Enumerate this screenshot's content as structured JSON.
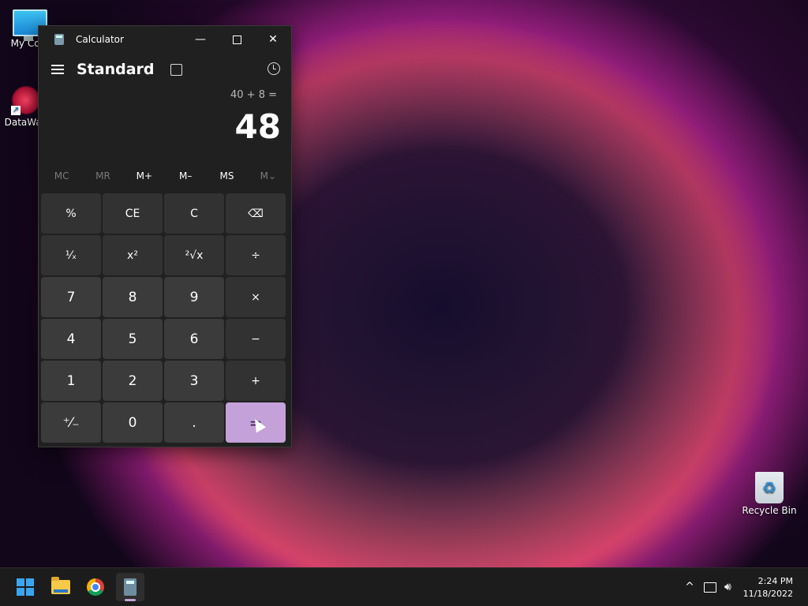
{
  "desktop": {
    "icons": [
      {
        "label": "My Com",
        "icon": "computer-icon"
      },
      {
        "label": "DataWag",
        "icon": "datawag-icon"
      },
      {
        "label": "Recycle Bin",
        "icon": "recycle-bin-icon"
      }
    ]
  },
  "calculator": {
    "window_title": "Calculator",
    "mode": "Standard",
    "expression": "40 + 8 =",
    "display": "48",
    "memory": [
      "MC",
      "MR",
      "M+",
      "M–",
      "MS",
      "M⌄"
    ],
    "keys": [
      [
        "%",
        "CE",
        "C",
        "⌫"
      ],
      [
        "¹⁄ₓ",
        "x²",
        "²√x",
        "÷"
      ],
      [
        "7",
        "8",
        "9",
        "×"
      ],
      [
        "4",
        "5",
        "6",
        "−"
      ],
      [
        "1",
        "2",
        "3",
        "+"
      ],
      [
        "⁺⁄₋",
        "0",
        ".",
        "="
      ]
    ],
    "accent_color": "#c4a1d8"
  },
  "taskbar": {
    "apps": [
      "start-icon",
      "file-explorer-icon",
      "chrome-icon",
      "calculator-icon"
    ],
    "tray_chevron": "^",
    "time": "2:24 PM",
    "date": "11/18/2022"
  }
}
